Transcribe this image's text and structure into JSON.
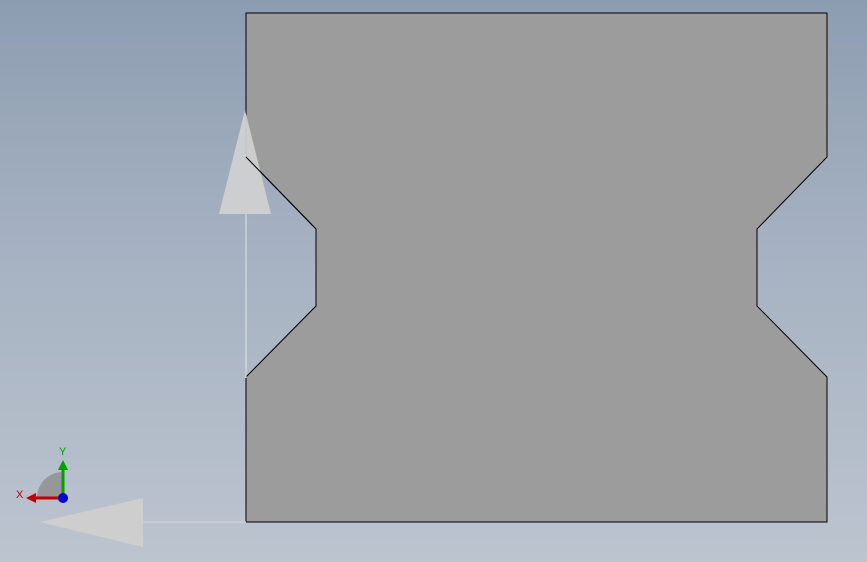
{
  "viewport": {
    "background_top": "#8d9db1",
    "background_bottom": "#bcc4cf",
    "part_fill": "#9c9c9c",
    "part_edge": "#000000",
    "manipulator_color": "#cfcfcf"
  },
  "triad": {
    "x_label": "X",
    "y_label": "Y",
    "x_color": "#c00000",
    "y_color": "#00a000",
    "z_color": "#0000d0"
  },
  "manipulators": {
    "vertical_arrow_icon": "arrow-up-icon",
    "horizontal_arrow_icon": "arrow-left-icon"
  }
}
